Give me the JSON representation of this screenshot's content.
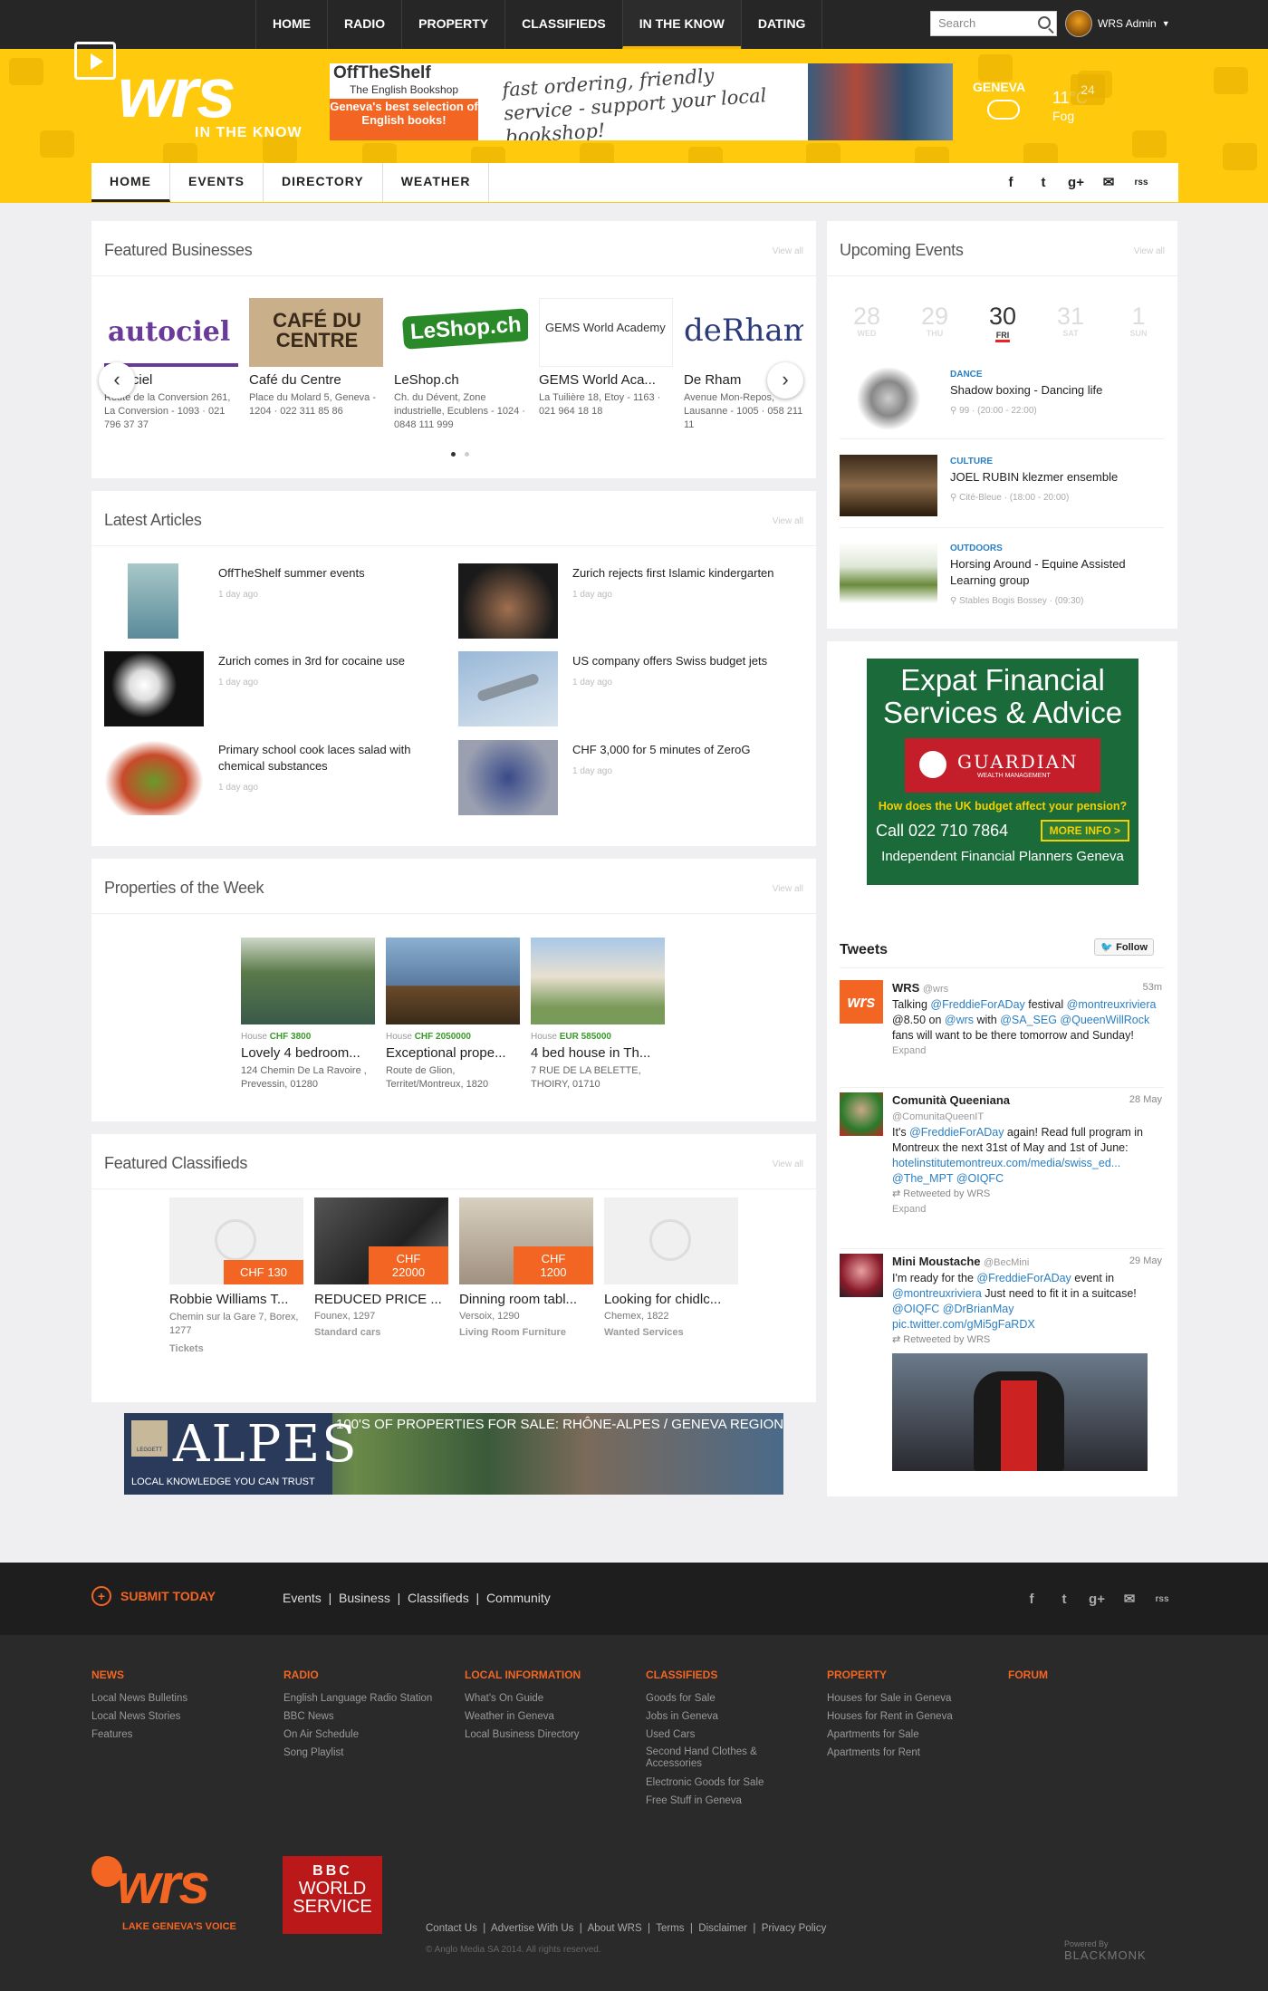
{
  "topnav": [
    "HOME",
    "RADIO",
    "PROPERTY",
    "CLASSIFIEDS",
    "IN THE KNOW",
    "DATING"
  ],
  "search_placeholder": "Search",
  "user_name": "WRS Admin",
  "logo_text": "wrs",
  "logo_sub": "IN THE KNOW",
  "banner_ad": {
    "brand": "OffTheShelf",
    "sub": "The English Bookshop",
    "slogan": "Geneva's best selection of English books!",
    "tagline": "fast ordering, friendly service - support your local bookshop!"
  },
  "weather": {
    "city": "GENEVA",
    "temp": "11°C",
    "condition": "Fog",
    "date_badge": "24"
  },
  "subnav": [
    "HOME",
    "EVENTS",
    "DIRECTORY",
    "WEATHER"
  ],
  "social": [
    "f",
    "t",
    "g+",
    "✉",
    "rss"
  ],
  "featured_businesses": {
    "title": "Featured Businesses",
    "view_all": "View all",
    "items": [
      {
        "logo": "autociel",
        "name": "Autociel",
        "address": "Route de la Conversion 261, La Conversion - 1093 · 021 796 37 37"
      },
      {
        "logo": "CAFÉ DU CENTRE",
        "name": "Café du Centre",
        "address": "Place du Molard 5, Geneva - 1204 · 022 311 85 86"
      },
      {
        "logo": "LeShop.ch",
        "name": "LeShop.ch",
        "address": "Ch. du Dévent, Zone industrielle, Ecublens - 1024 · 0848 111 999"
      },
      {
        "logo": "GEMS World Academy",
        "name": "GEMS World Aca...",
        "address": "La Tuilière 18, Etoy - 1163 · 021 964 18 18"
      },
      {
        "logo": "deRham",
        "name": "De Rham",
        "address": "Avenue Mon-Repos, Lausanne - 1005 · 058 211 11"
      }
    ]
  },
  "latest_articles": {
    "title": "Latest Articles",
    "view_all": "View all",
    "items": [
      {
        "title": "OffTheShelf summer events",
        "time": "1 day ago"
      },
      {
        "title": "Zurich rejects first Islamic kindergarten",
        "time": "1 day ago"
      },
      {
        "title": "Zurich comes in 3rd for cocaine use",
        "time": "1 day ago"
      },
      {
        "title": "US company offers Swiss budget jets",
        "time": "1 day ago"
      },
      {
        "title": "Primary school cook laces salad with chemical substances",
        "time": "1 day ago"
      },
      {
        "title": "CHF 3,000 for 5 minutes of ZeroG",
        "time": "1 day ago"
      }
    ]
  },
  "properties": {
    "title": "Properties of the Week",
    "view_all": "View all",
    "items": [
      {
        "type": "House",
        "price": "CHF 3800",
        "name": "Lovely 4 bedroom...",
        "address": "124 Chemin De La Ravoire , Prevessin, 01280"
      },
      {
        "type": "House",
        "price": "CHF 2050000",
        "name": "Exceptional prope...",
        "address": "Route de Glion, Territet/Montreux, 1820"
      },
      {
        "type": "House",
        "price": "EUR 585000",
        "name": "4 bed house in Th...",
        "address": "7 RUE DE LA BELETTE, THOIRY, 01710"
      }
    ]
  },
  "classifieds": {
    "title": "Featured Classifieds",
    "view_all": "View all",
    "items": [
      {
        "price": "CHF 130",
        "name": "Robbie Williams T...",
        "address": "Chemin sur la Gare 7, Borex, 1277",
        "category": "Tickets"
      },
      {
        "price": "CHF 22000",
        "name": "REDUCED PRICE ...",
        "address": "Founex, 1297",
        "category": "Standard cars"
      },
      {
        "price": "CHF 1200",
        "name": "Dinning room tabl...",
        "address": "Versoix, 1290",
        "category": "Living Room Furniture"
      },
      {
        "price": "",
        "name": "Looking for chidlc...",
        "address": "Chemex, 1822",
        "category": "Wanted Services"
      }
    ]
  },
  "bottom_ad": {
    "brand": "ALPES",
    "company": "LEGGETT",
    "slogan": "LOCAL KNOWLEDGE YOU CAN TRUST",
    "headline": "100'S OF PROPERTIES FOR SALE: RHÔNE-ALPES / GENEVA REGION"
  },
  "events": {
    "title": "Upcoming Events",
    "view_all": "View all",
    "days": [
      {
        "n": "28",
        "d": "WED"
      },
      {
        "n": "29",
        "d": "THU"
      },
      {
        "n": "30",
        "d": "FRI"
      },
      {
        "n": "31",
        "d": "SAT"
      },
      {
        "n": "1",
        "d": "SUN"
      }
    ],
    "items": [
      {
        "category": "DANCE",
        "title": "Shadow boxing - Dancing life",
        "location": "99",
        "time": "(20:00 - 22:00)"
      },
      {
        "category": "CULTURE",
        "title": "JOEL RUBIN klezmer ensemble",
        "location": "Cité-Bleue",
        "time": "(18:00 - 20:00)"
      },
      {
        "category": "OUTDOORS",
        "title": "Horsing Around - Equine Assisted Learning group",
        "location": "Stables Bogis Bossey",
        "time": "(09:30)"
      }
    ]
  },
  "side_ad": {
    "line1": "Expat Financial",
    "line2": "Services & Advice",
    "brand": "GUARDIAN",
    "brand_sub": "WEALTH MANAGEMENT",
    "question": "How does the UK budget affect your pension?",
    "phone": "Call 022 710 7864",
    "cta": "MORE INFO >",
    "footer": "Independent Financial Planners Geneva"
  },
  "tweets": {
    "title": "Tweets",
    "follow": "Follow",
    "items": [
      {
        "name": "WRS",
        "handle": "@wrs",
        "date": "53m",
        "text_a": "Talking ",
        "m1": "@FreddieForADay",
        "text_b": " festival ",
        "m2": "@montreuxriviera",
        "text_c": " @8.50 on ",
        "m3": "@wrs",
        "text_d": " with ",
        "m4": "@SA_SEG",
        "text_e": " ",
        "m5": "@QueenWillRock",
        "text_f": " fans will want to be there tomorrow and Sunday!",
        "expand": "Expand"
      },
      {
        "name": "Comunità Queeniana",
        "handle": "@ComunitaQueenIT",
        "date": "28 May",
        "text_a": "It's ",
        "m1": "@FreddieForADay",
        "text_b": " again! Read full program in Montreux the next 31st of May and 1st of June: ",
        "link": "hotelinstitutemontreux.com/media/swiss_ed...",
        "m2": "@The_MPT",
        "m3": "@OIQFC",
        "retweet": "Retweeted by WRS",
        "expand": "Expand"
      },
      {
        "name": "Mini Moustache",
        "handle": "@BecMini",
        "date": "29 May",
        "text_a": "I'm ready for the ",
        "m1": "@FreddieForADay",
        "text_b": " event in ",
        "m2": "@montreuxriviera",
        "text_c": " Just need to fit it in a suitcase! ",
        "m3": "@OIQFC",
        "m4": "@DrBrianMay",
        "link": "pic.twitter.com/gMi5gFaRDX",
        "retweet": "Retweeted by WRS"
      }
    ]
  },
  "footer": {
    "submit": "SUBMIT TODAY",
    "links": [
      "Events",
      "Business",
      "Classifieds",
      "Community"
    ],
    "cols": [
      {
        "h": "NEWS",
        "items": [
          "Local News Bulletins",
          "Local News Stories",
          "Features"
        ]
      },
      {
        "h": "RADIO",
        "items": [
          "English Language Radio Station",
          "BBC News",
          "On Air Schedule",
          "Song Playlist"
        ]
      },
      {
        "h": "LOCAL INFORMATION",
        "items": [
          "What's On Guide",
          "Weather in Geneva",
          "Local Business Directory"
        ]
      },
      {
        "h": "CLASSIFIEDS",
        "items": [
          "Goods for Sale",
          "Jobs in Geneva",
          "Used Cars",
          "Second Hand Clothes & Accessories",
          "Electronic Goods for Sale",
          "Free Stuff in Geneva"
        ]
      },
      {
        "h": "PROPERTY",
        "items": [
          "Houses for Sale in Geneva",
          "Houses for Rent in Geneva",
          "Apartments for Sale",
          "Apartments for Rent"
        ]
      },
      {
        "h": "FORUM",
        "items": []
      }
    ],
    "logo_tagline": "LAKE GENEVA'S VOICE",
    "bbc": [
      "BBC",
      "WORLD",
      "SERVICE"
    ],
    "bottom_links": [
      "Contact Us",
      "Advertise With Us",
      "About WRS",
      "Terms",
      "Disclaimer",
      "Privacy Policy"
    ],
    "copyright": "© Anglo Media SA 2014. All rights reserved.",
    "powered_by": "Powered By",
    "powered_brand": "BLACKMONK"
  },
  "colors": {
    "accent": "#ffc90e",
    "orange": "#f26522",
    "dark": "#262626",
    "link": "#2a7fc3"
  }
}
